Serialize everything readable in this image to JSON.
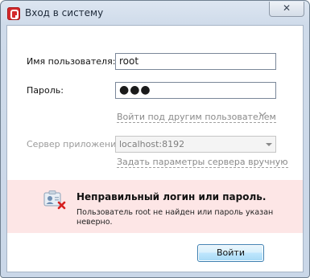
{
  "window": {
    "title": "Вход в систему",
    "close_glyph": "✕"
  },
  "form": {
    "username_label": "Имя пользователя:",
    "username_value": "root",
    "password_label": "Пароль:",
    "password_mask": "●●●",
    "switch_user_link": "Войти под другим пользователем",
    "server_label": "Сервер приложений:",
    "server_value": "localhost:8192",
    "server_manual_link": "Задать параметры сервера вручную"
  },
  "error": {
    "title": "Неправильный логин или пароль.",
    "message": "Пользователь root не найден или пароль указан неверно."
  },
  "buttons": {
    "login_label": "Войти"
  },
  "colors": {
    "error_background": "#fde6e6",
    "app_icon_red": "#d3292b",
    "link_gray": "#8a8a8a"
  },
  "icons": {
    "app": "app-logo-icon",
    "error": "user-card-error-icon",
    "chevron": "chevron-down-icon",
    "dropdown": "dropdown-arrow-icon",
    "close": "close-icon"
  }
}
